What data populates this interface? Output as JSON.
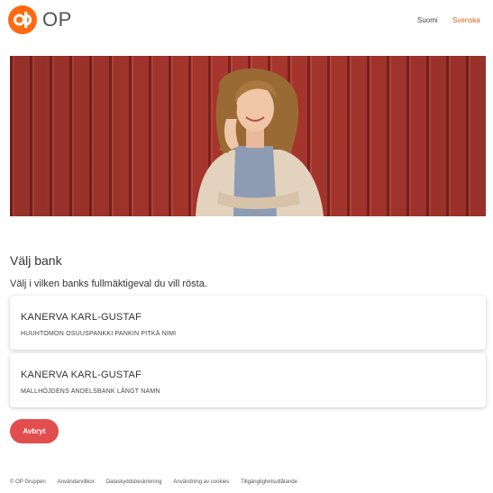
{
  "header": {
    "logo_text": "OP",
    "brand_color": "#ff6a10",
    "languages": [
      "Suomi",
      "Svenska"
    ],
    "active_language": "Svenska"
  },
  "main": {
    "title": "Välj bank",
    "subtitle": "Välj i vilken banks fullmäktigeval du vill rösta.",
    "banks": [
      {
        "name": "KANERVA KARL-GUSTAF",
        "bank": "HUUHTOMON OSUUSPANKKI PANKIN PITKÄ NIMI"
      },
      {
        "name": "KANERVA KARL-GUSTAF",
        "bank": "MALLHÖJDENS ANDELSBANK LÅNGT NAMN"
      }
    ],
    "cancel_label": "Avbryt",
    "cancel_color": "#e24d4d"
  },
  "footer": {
    "copyright": "© OP Gruppen",
    "links": [
      "Användarvillkor",
      "Dataskyddsbeskrivning",
      "Användning av cookies",
      "Tillgänglighetsutlåtande"
    ]
  }
}
